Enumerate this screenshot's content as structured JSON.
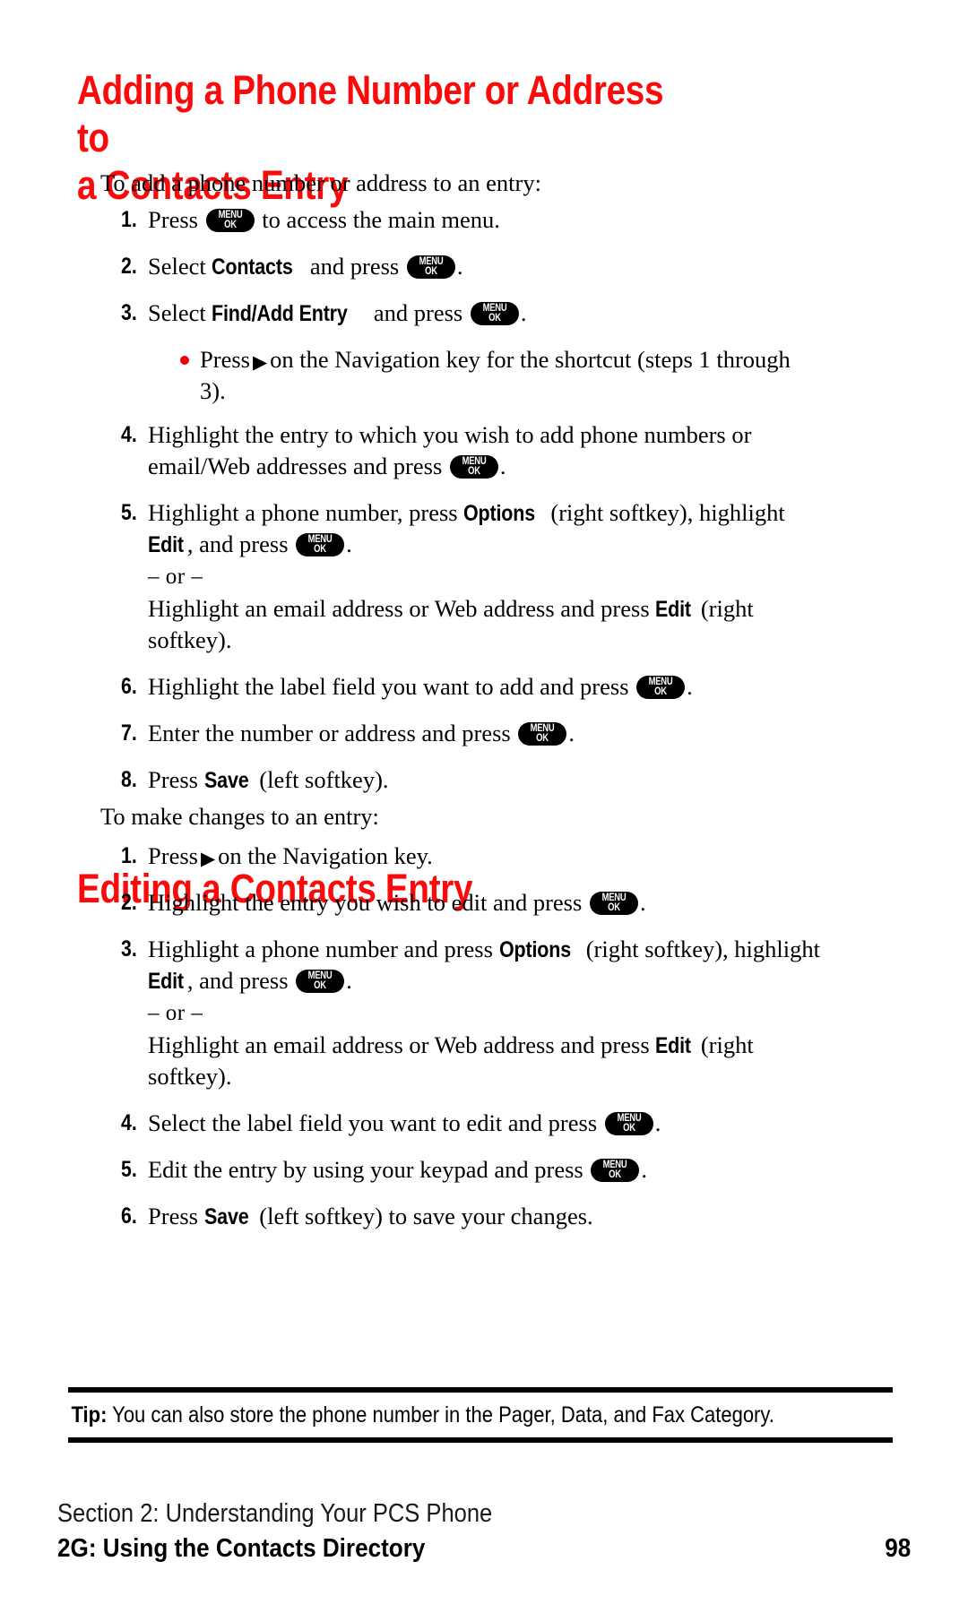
{
  "page": {
    "heading_1": "Adding a Phone Number or Address to\na Contacts Entry",
    "heading_2": "Editing a Contacts Entry",
    "accent_color": "#fa0a0a",
    "bullet_color": "#ee0000"
  },
  "key_glyph": {
    "menu_label": "MENU",
    "ok_label": "OK",
    "nav_right_arrow": "▶"
  },
  "section_1": {
    "intro": "To add a phone number or address to an entry:",
    "steps": [
      {
        "number": "1.",
        "parts": [
          {
            "type": "text",
            "value": "Press "
          },
          {
            "type": "menukey"
          },
          {
            "type": "text",
            "value": " to access the main menu."
          }
        ]
      },
      {
        "number": "2.",
        "parts": [
          {
            "type": "text",
            "value": "Select "
          },
          {
            "type": "bold",
            "value": "Contacts"
          },
          {
            "type": "text",
            "value": " and press "
          },
          {
            "type": "menukey"
          },
          {
            "type": "text",
            "value": "."
          }
        ]
      },
      {
        "number": "3.",
        "parts": [
          {
            "type": "text",
            "value": "Select "
          },
          {
            "type": "bold",
            "value": "Find/Add Entry"
          },
          {
            "type": "text",
            "value": " and press "
          },
          {
            "type": "menukey"
          },
          {
            "type": "text",
            "value": "."
          }
        ],
        "bullet": {
          "parts": [
            {
              "type": "text",
              "value": "Press"
            },
            {
              "type": "navarrow"
            },
            {
              "type": "text",
              "value": "on the Navigation key for the shortcut (steps 1 through 3)."
            }
          ]
        }
      },
      {
        "number": "4.",
        "parts": [
          {
            "type": "text",
            "value": "Highlight the entry to which you wish to add phone numbers or email/Web addresses and press "
          },
          {
            "type": "menukey"
          },
          {
            "type": "text",
            "value": "."
          }
        ]
      },
      {
        "number": "5.",
        "parts": [
          {
            "type": "text",
            "value": "Highlight a phone number, press "
          },
          {
            "type": "bold",
            "value": "Options"
          },
          {
            "type": "text",
            "value": " (right softkey), highlight "
          },
          {
            "type": "bold",
            "value": "Edit"
          },
          {
            "type": "text",
            "value": ", and press "
          },
          {
            "type": "menukey"
          },
          {
            "type": "text",
            "value": "."
          },
          {
            "type": "or"
          },
          {
            "type": "text",
            "value": "Highlight an email address or Web address and press "
          },
          {
            "type": "bold",
            "value": "Edit"
          },
          {
            "type": "text",
            "value": " (right softkey)."
          }
        ]
      },
      {
        "number": "6.",
        "parts": [
          {
            "type": "text",
            "value": "Highlight the label field you want to add and press "
          },
          {
            "type": "menukey"
          },
          {
            "type": "text",
            "value": "."
          }
        ]
      },
      {
        "number": "7.",
        "parts": [
          {
            "type": "text",
            "value": "Enter the number or address and press "
          },
          {
            "type": "menukey"
          },
          {
            "type": "text",
            "value": "."
          }
        ]
      },
      {
        "number": "8.",
        "parts": [
          {
            "type": "text",
            "value": "Press "
          },
          {
            "type": "bold",
            "value": "Save"
          },
          {
            "type": "text",
            "value": " (left softkey)."
          }
        ]
      }
    ]
  },
  "section_2": {
    "intro": "To make changes to an entry:",
    "steps": [
      {
        "number": "1.",
        "parts": [
          {
            "type": "text",
            "value": "Press"
          },
          {
            "type": "navarrow"
          },
          {
            "type": "text",
            "value": "on the Navigation key."
          }
        ]
      },
      {
        "number": "2.",
        "parts": [
          {
            "type": "text",
            "value": "Highlight the entry you wish to edit and press "
          },
          {
            "type": "menukey"
          },
          {
            "type": "text",
            "value": "."
          }
        ]
      },
      {
        "number": "3.",
        "parts": [
          {
            "type": "text",
            "value": "Highlight a phone number and press "
          },
          {
            "type": "bold",
            "value": "Options"
          },
          {
            "type": "text",
            "value": " (right softkey), highlight "
          },
          {
            "type": "bold",
            "value": "Edit"
          },
          {
            "type": "text",
            "value": ", and press "
          },
          {
            "type": "menukey"
          },
          {
            "type": "text",
            "value": "."
          },
          {
            "type": "or"
          },
          {
            "type": "text",
            "value": "Highlight an email address or Web address and press "
          },
          {
            "type": "bold",
            "value": "Edit"
          },
          {
            "type": "text",
            "value": " (right softkey)."
          }
        ]
      },
      {
        "number": "4.",
        "parts": [
          {
            "type": "text",
            "value": "Select the label field you want to edit and press "
          },
          {
            "type": "menukey"
          },
          {
            "type": "text",
            "value": "."
          }
        ]
      },
      {
        "number": "5.",
        "parts": [
          {
            "type": "text",
            "value": "Edit the entry by using your keypad and press "
          },
          {
            "type": "menukey"
          },
          {
            "type": "text",
            "value": "."
          }
        ]
      },
      {
        "number": "6.",
        "parts": [
          {
            "type": "text",
            "value": "Press "
          },
          {
            "type": "bold",
            "value": "Save"
          },
          {
            "type": "text",
            "value": " (left softkey) to save your changes."
          }
        ]
      }
    ]
  },
  "or_separator": "– or –",
  "tip": {
    "label": "Tip:",
    "text": " You can also store the phone number in the Pager, Data, and Fax Category."
  },
  "footer": {
    "section_line": "Section 2: Understanding Your PCS Phone",
    "chapter_line": "2G: Using the Contacts Directory",
    "page_number": "98"
  }
}
